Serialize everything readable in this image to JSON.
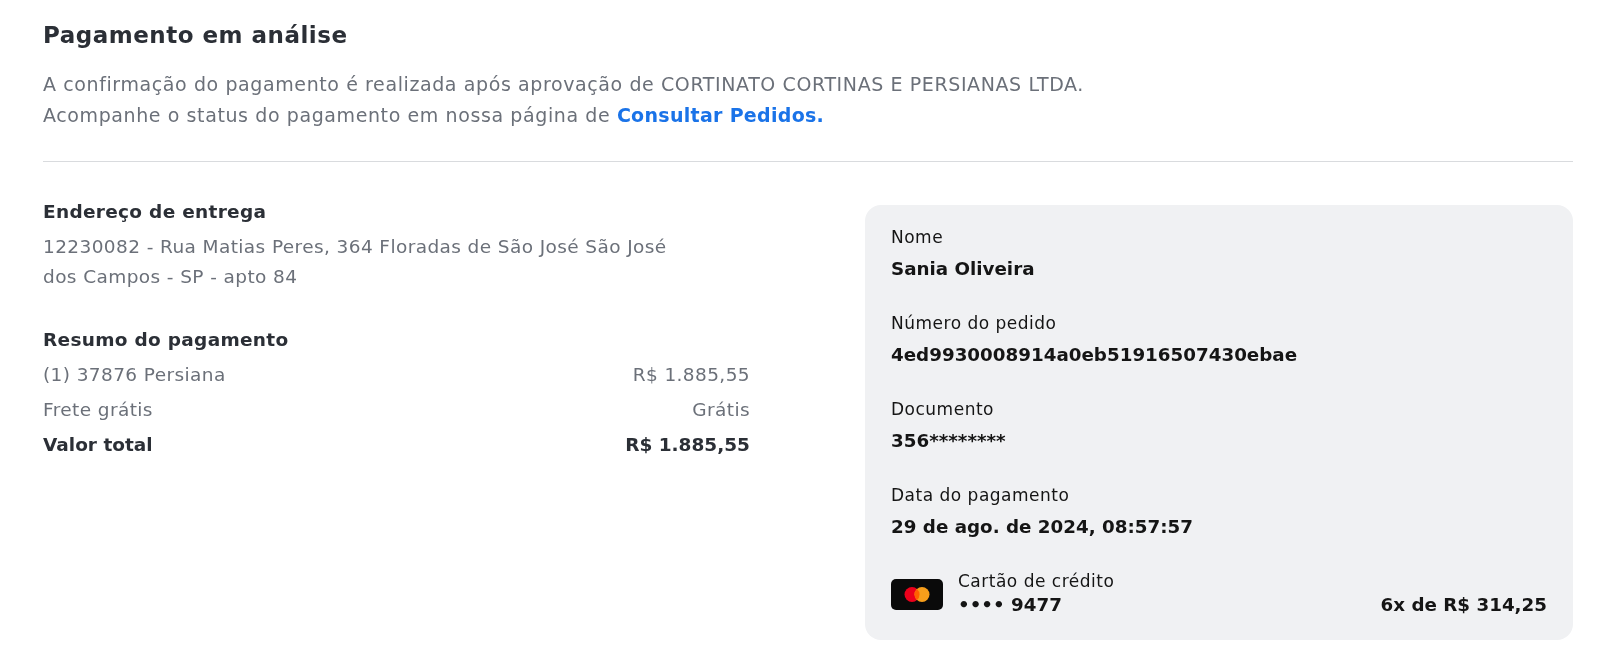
{
  "header": {
    "title": "Pagamento em análise",
    "lines": [
      {
        "text": "A confirmação do pagamento é realizada após aprovação de CORTINATO CORTINAS E PERSIANAS LTDA."
      },
      {
        "text": "Acompanhe o status do pagamento em nossa página de",
        "link": "Consultar Pedidos."
      }
    ]
  },
  "delivery": {
    "heading": "Endereço de entrega",
    "address": "12230082 - Rua Matias Peres, 364 Floradas de São José São José dos Campos - SP - apto 84"
  },
  "summary": {
    "heading": "Resumo do pagamento",
    "rows": [
      {
        "kind": "item",
        "label": "(1) 37876 Persiana",
        "value": "R$ 1.885,55"
      },
      {
        "kind": "item",
        "label": "Frete grátis",
        "value": "Grátis"
      },
      {
        "kind": "total",
        "label": "Valor total",
        "value": "R$ 1.885,55"
      }
    ]
  },
  "details": {
    "fields": [
      {
        "label": "Nome",
        "value": "Sania Oliveira"
      },
      {
        "label": "Número do pedido",
        "value": "4ed9930008914a0eb51916507430ebae"
      },
      {
        "label": "Documento",
        "value": "356********"
      },
      {
        "label": "Data do pagamento",
        "value": "29 de ago. de 2024, 08:57:57"
      }
    ],
    "payment": {
      "method": "Cartão de crédito",
      "card": "•••• 9477",
      "installments": "6x de R$ 314,25"
    }
  }
}
